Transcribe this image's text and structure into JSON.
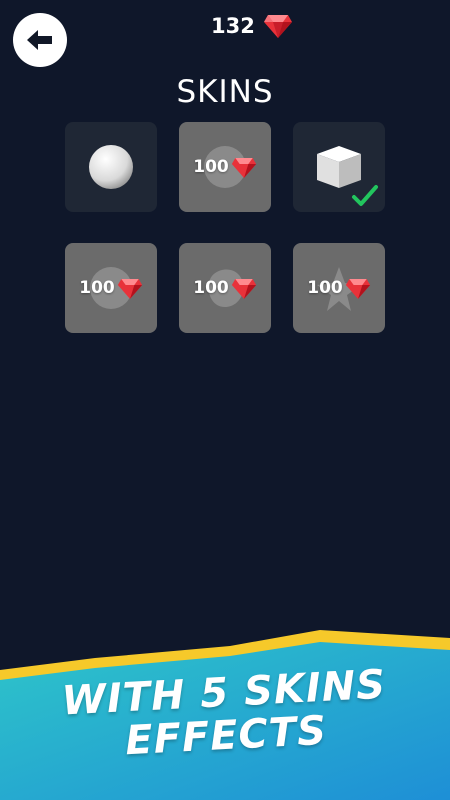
{
  "header": {
    "back_icon": "arrow-left-icon",
    "gem_count": "132",
    "gem_icon": "ruby-gem-icon"
  },
  "title": "SKINS",
  "skins": [
    {
      "shape": "sphere",
      "state": "owned",
      "selected": false,
      "price": ""
    },
    {
      "shape": "sphere",
      "state": "locked",
      "selected": false,
      "price": "100"
    },
    {
      "shape": "cube",
      "state": "owned",
      "selected": true,
      "price": ""
    },
    {
      "shape": "sphere",
      "state": "locked",
      "selected": false,
      "price": "100"
    },
    {
      "shape": "blob",
      "state": "locked",
      "selected": false,
      "price": "100"
    },
    {
      "shape": "star",
      "state": "locked",
      "selected": false,
      "price": "100"
    }
  ],
  "banner": {
    "line1": "WITH 5 SKINS",
    "line2": "EFFECTS"
  },
  "colors": {
    "background": "#0f172a",
    "cell_owned": "#1f2735",
    "cell_locked": "#6b6b6b",
    "gem_red": "#e8323a",
    "check_green": "#22c55e",
    "banner_yellow": "#f6c92a",
    "banner_teal": "#2ec5c9",
    "banner_blue": "#1e8fd6"
  }
}
